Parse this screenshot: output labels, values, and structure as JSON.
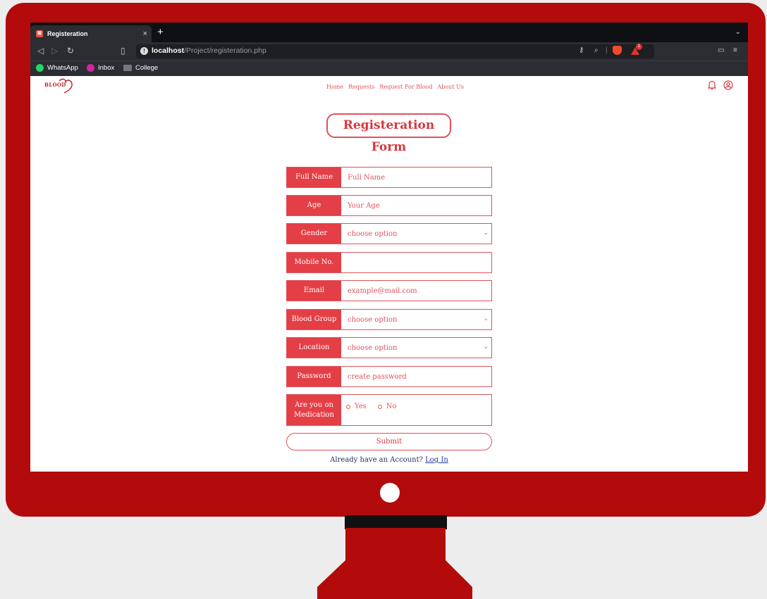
{
  "browser": {
    "tab_title": "Registeration",
    "tab_close": "×",
    "new_tab": "+",
    "url_host": "localhost",
    "url_path": "/Project/registeration.php",
    "reward_count": "1",
    "bookmarks": [
      "WhatsApp",
      "Inbox",
      "College"
    ]
  },
  "site": {
    "logo": "BLOOD",
    "nav": [
      "Home",
      "Requests",
      "Request For Blood",
      "About Us"
    ]
  },
  "form": {
    "title": "Registeration Form",
    "fields": [
      {
        "label": "Full Name",
        "value": "Full Name"
      },
      {
        "label": "Age",
        "value": "Your Age"
      },
      {
        "label": "Gender",
        "value": "choose option"
      },
      {
        "label": "Mobile No.",
        "value": ""
      },
      {
        "label": "Email",
        "value": "example@mail.com"
      },
      {
        "label": "Blood Group",
        "value": "choose option"
      },
      {
        "label": "Location",
        "value": "choose option"
      },
      {
        "label": "Password",
        "value": "create password"
      },
      {
        "label": "Are you on Medication",
        "options": [
          "Yes",
          "No"
        ]
      }
    ],
    "submit": "Submit",
    "login_prompt": "Already have an Account?",
    "login_link": "Log In"
  },
  "colors": {
    "monitor": "#b30b0b",
    "accent": "#e43f46"
  }
}
